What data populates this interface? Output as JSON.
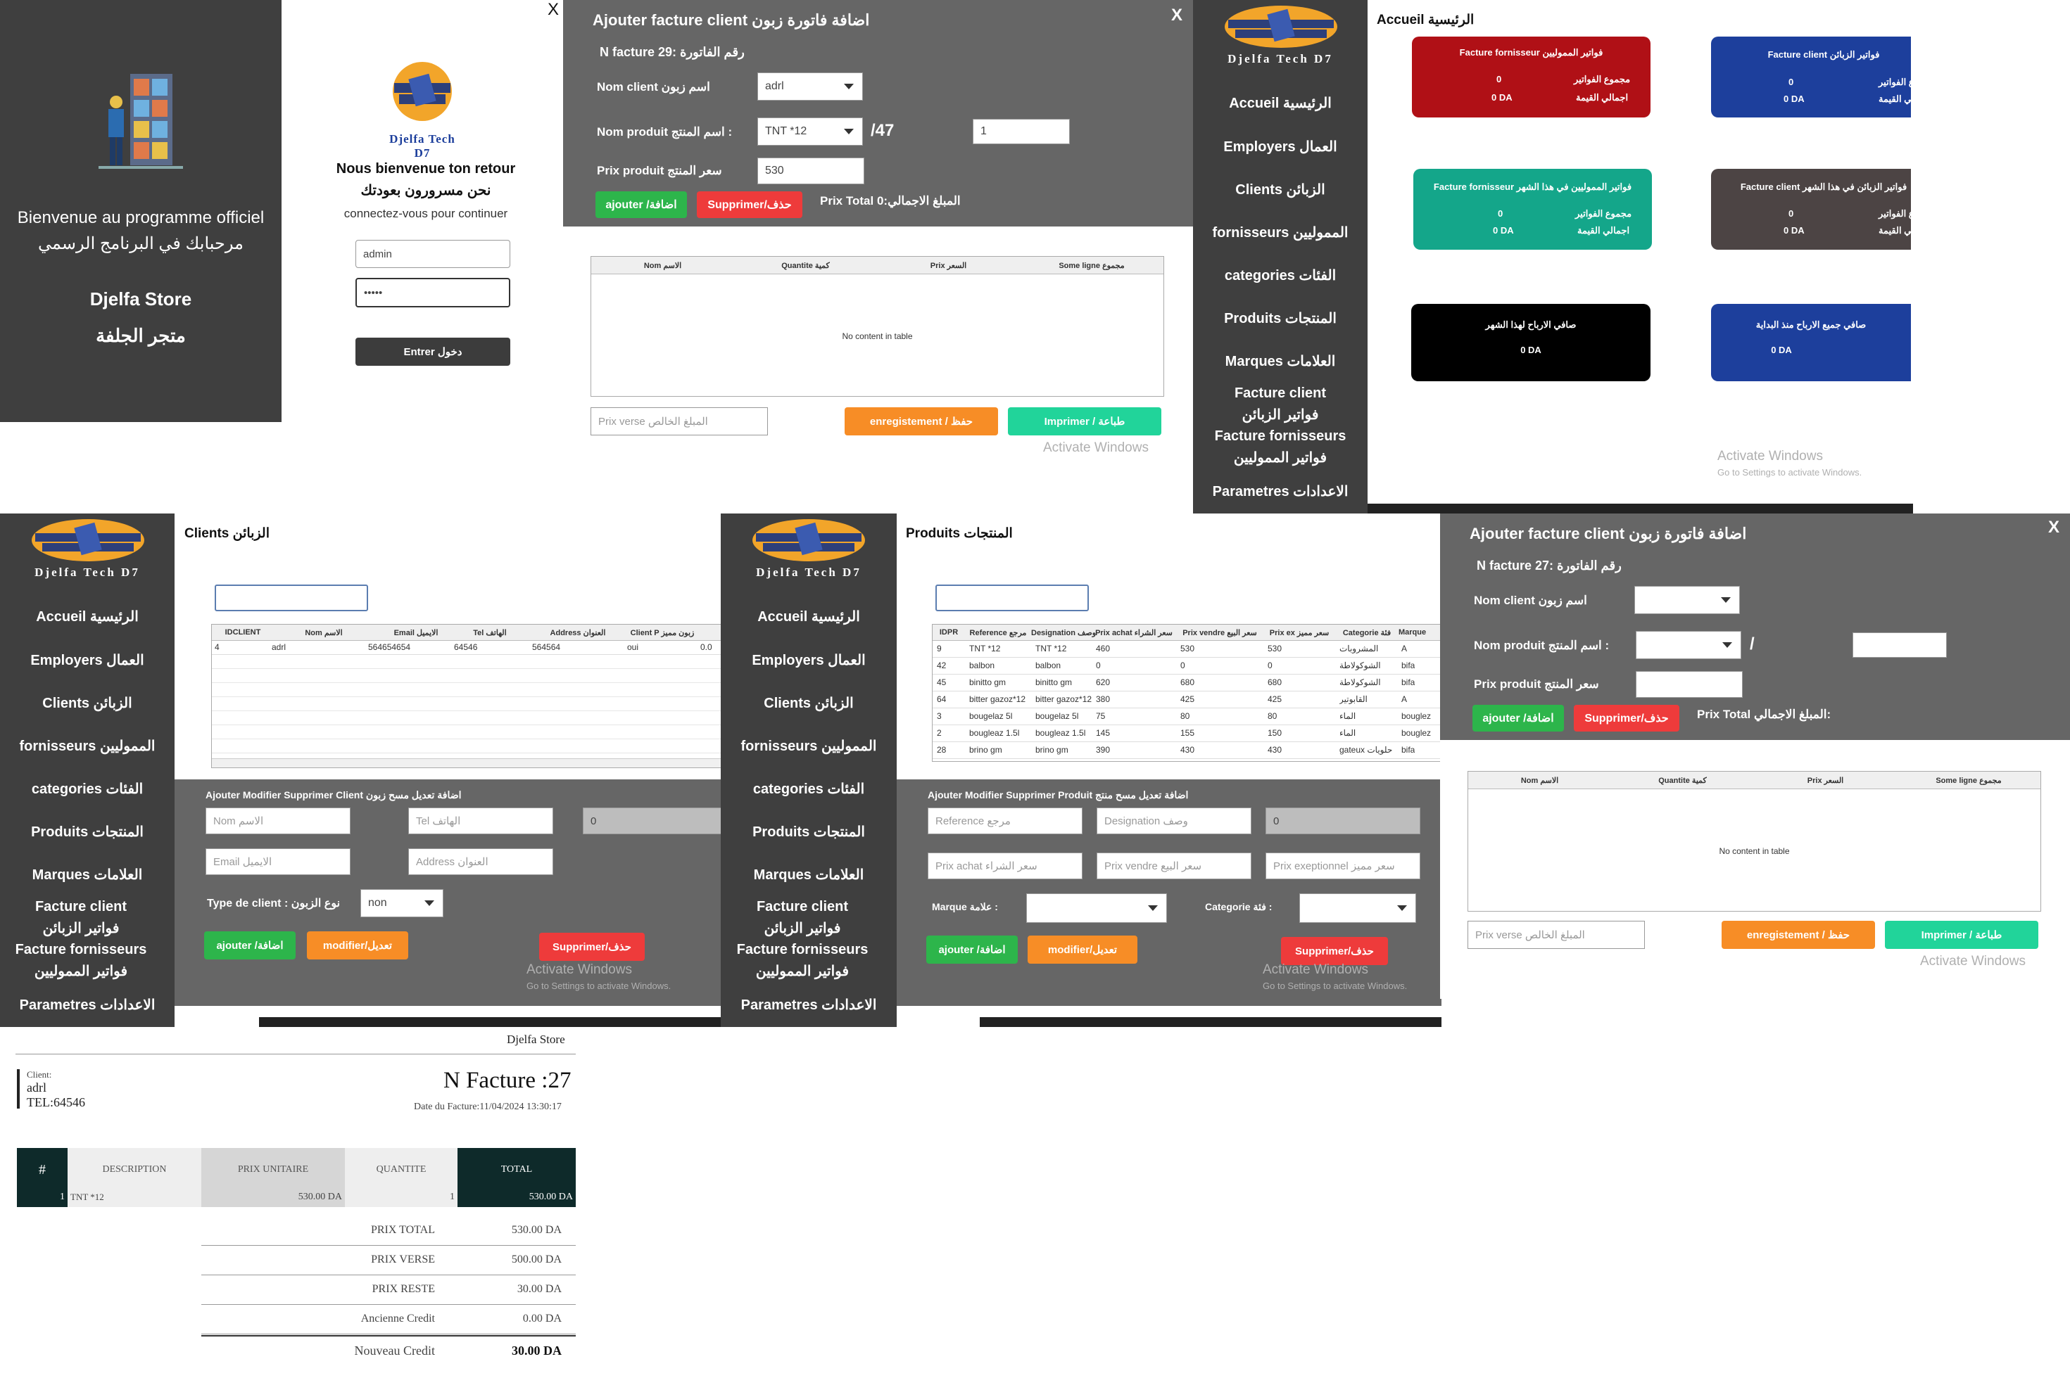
{
  "welcome": {
    "line1": "Bienvenue au programme officiel",
    "line2": "مرحبابك في البرنامج الرسمي",
    "store_fr": "Djelfa Store",
    "store_ar": "متجر الجلفة"
  },
  "login": {
    "close": "X",
    "brand": "Djelfa Tech D7",
    "greeting_fr": "Nous bienvenue ton retour",
    "greeting_ar": "نحن مسرورون بعودتك",
    "subtitle": "connectez-vous pour continuer",
    "username": "admin",
    "password": "•••••",
    "submit": "Entrer دخول"
  },
  "brand": "Djelfa Tech D7",
  "nav": {
    "home": "Accueil الرئيسية",
    "employees": "Employers العمال",
    "clients": "Clients الزبائن",
    "suppliers": "fornisseurs المموليين",
    "categories": "categories الفئات",
    "products": "Produits المنتجات",
    "brands": "Marques العلامات",
    "invoice_client_fr": "Facture client",
    "invoice_client_ar": "فواتير الزبائن",
    "invoice_supplier_fr": "Facture fornisseurs",
    "invoice_supplier_ar": "فواتير المموليين",
    "settings": "Parametres الاعدادات"
  },
  "invoice1": {
    "title": "Ajouter facture client اضافة فاتورة زبون",
    "close": "X",
    "number": "N facture 29: رقم الفاتورة",
    "client_label": "Nom client اسم زبون",
    "client_value": "adrl",
    "product_label": "Nom produit اسم المنتج :",
    "product_value": "TNT *12",
    "stock": "/47",
    "qty": "1",
    "price_label": "Prix produit سعر المنتج",
    "price_value": "530",
    "add": "ajouter /اضافة",
    "delete": "Supprimer/حذف",
    "total": "Prix Total المبلغ الاجمالي:0",
    "columns": [
      "Nom الاسم",
      "Quantite كمية",
      "Prix السعر",
      "Some ligne مجموع"
    ],
    "empty": "No content in table",
    "paid_placeholder": "Prix verse المبلغ الخالص",
    "save": "enregistement / حفظ",
    "print": "Imprimer / طباعة",
    "watermark": "Activate Windows"
  },
  "home": {
    "title": "Accueil الرئيسية",
    "cards": [
      {
        "title": "Facture fornisseur فواتير المموليين",
        "row1_ar": "مجموع الفواتير",
        "row1_val": "0",
        "row2_ar": "اجمالي القيمة",
        "row2_val": "0 DA",
        "color": "#b01016"
      },
      {
        "title": "Facture client فواتير الزبائن",
        "row1_ar": "مجموع الفواتير",
        "row1_val": "0",
        "row2_ar": "اجمالي القيمة",
        "row2_val": "0 DA",
        "color": "#1d3f9c"
      },
      {
        "title": "Facture fornisseur فواتير المموليين في هذا الشهر",
        "row1_ar": "مجموع الفواتير",
        "row1_val": "0",
        "row2_ar": "اجمالي القيمة",
        "row2_val": "0 DA",
        "color": "#14a68a"
      },
      {
        "title": "Facture client فواتير الزبائن في هذا الشهر",
        "row1_ar": "مجموع الفواتير",
        "row1_val": "0",
        "row2_ar": "اجمالي القيمة",
        "row2_val": "0 DA",
        "color": "#4c4444"
      },
      {
        "title": "صافي الارباح لهذا الشهر",
        "value": "0 DA",
        "color": "#000000"
      },
      {
        "title": "صافي جميع الارباح منذ البداية",
        "value": "0 DA",
        "color": "#1d3f9c"
      }
    ],
    "watermark1": "Activate Windows",
    "watermark2": "Go to Settings to activate Windows."
  },
  "clients": {
    "title": "Clients الزبائن",
    "columns": [
      "IDCLIENT",
      "Nom الاسم",
      "Email الايميل",
      "Tel الهاتف",
      "Address العنوان",
      "Client P زبون مميز"
    ],
    "row": [
      "4",
      "adrl",
      "564654654",
      "64546",
      "564564",
      "oui",
      "0.0"
    ],
    "form_title": "Ajouter Modifier Supprimer Client اضافة تعديل مسح زبون",
    "name_ph": "Nom الاسم",
    "tel_ph": "Tel الهاتف",
    "zero": "0",
    "email_ph": "Email الايميل",
    "address_ph": "Address العنوان",
    "type_label": "Type de client : نوع الزبون",
    "type_value": "non",
    "add": "ajouter /اضافة",
    "modify": "modifier/تعديل",
    "delete": "Supprimer/حذف",
    "watermark1": "Activate Windows",
    "watermark2": "Go to Settings to activate Windows."
  },
  "products": {
    "title": "Produits المنتجات",
    "columns": [
      "IDPR",
      "Reference مرجع",
      "Designation وصف",
      "Prix achat سعر الشراء",
      "Prix vendre سعر البيع",
      "Prix ex سعر مميز",
      "Categorie فئة",
      "Marque"
    ],
    "rows": [
      [
        "9",
        "TNT *12",
        "TNT *12",
        "460",
        "530",
        "530",
        "المشروبات",
        "A"
      ],
      [
        "42",
        "balbon",
        "balbon",
        "0",
        "0",
        "0",
        "الشوكولاطة",
        "bifa"
      ],
      [
        "45",
        "binitto gm",
        "binitto gm",
        "620",
        "680",
        "680",
        "الشوكولاطة",
        "bifa"
      ],
      [
        "64",
        "bitter gazoz*12",
        "bitter gazoz*12",
        "380",
        "425",
        "425",
        "القابوتير",
        "A"
      ],
      [
        "3",
        "bougelaz 5l",
        "bougelaz 5l",
        "75",
        "80",
        "80",
        "الماء",
        "bouglez"
      ],
      [
        "2",
        "bougleaz 1.5l",
        "bougleaz 1.5l",
        "145",
        "155",
        "150",
        "الماء",
        "bouglez"
      ],
      [
        "28",
        "brino gm",
        "brino gm",
        "390",
        "430",
        "430",
        "gateux حلويات",
        "bifa"
      ]
    ],
    "form_title": "Ajouter Modifier Supprimer Produit اضافة تعديل مسح منتج",
    "ref_ph": "Reference مرجع",
    "desig_ph": "Designation وصف",
    "zero": "0",
    "achat_ph": "Prix achat سعر الشراء",
    "vendre_ph": "Prix vendre سعر البيع",
    "except_ph": "Prix exeptionnel سعر مميز",
    "brand_label": "Marque علامة :",
    "cat_label": "Categorie فئة :",
    "add": "ajouter /اضافة",
    "modify": "modifier/تعديل",
    "delete": "Supprimer/حذف",
    "watermark1": "Activate Windows",
    "watermark2": "Go to Settings to activate Windows."
  },
  "invoice2": {
    "title": "Ajouter facture client اضافة فاتورة زبون",
    "close": "X",
    "number": "N facture 27: رقم الفاتورة",
    "client_label": "Nom client اسم زبون",
    "product_label": "Nom produit اسم المنتج :",
    "slash": "/",
    "price_label": "Prix produit سعر المنتج",
    "add": "ajouter /اضافة",
    "delete": "Supprimer/حذف",
    "total": "Prix Total المبلغ الاجمالي:",
    "columns": [
      "Nom الاسم",
      "Quantite كمية",
      "Prix السعر",
      "Some ligne مجموع"
    ],
    "empty": "No content in table",
    "paid_placeholder": "Prix verse المبلغ الخالص",
    "save": "enregistement / حفظ",
    "print": "Imprimer / طباعة",
    "watermark": "Activate Windows"
  },
  "receipt": {
    "store": "Djelfa Store",
    "client_label": "Client:",
    "client_name": "adrl",
    "client_tel": "TEL:64546",
    "title": "N Facture :27",
    "date": "Date du Facture:11/04/2024 13:30:17",
    "columns": [
      "#",
      "DESCRIPTION",
      "PRIX UNITAIRE",
      "QUANTITE",
      "TOTAL"
    ],
    "row": [
      "1",
      "TNT *12",
      "530.00 DA",
      "1",
      "530.00 DA"
    ],
    "summary": [
      {
        "label": "PRIX TOTAL",
        "value": "530.00 DA"
      },
      {
        "label": "PRIX VERSE",
        "value": "500.00 DA"
      },
      {
        "label": "PRIX RESTE",
        "value": "30.00 DA"
      },
      {
        "label": "Ancienne Credit",
        "value": "0.00 DA"
      },
      {
        "label": "Nouveau Credit",
        "value": "30.00 DA"
      }
    ]
  }
}
